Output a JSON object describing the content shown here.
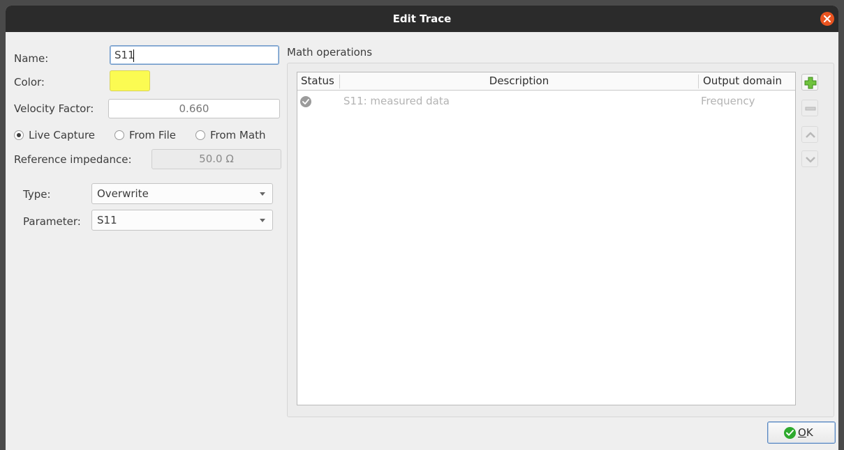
{
  "window": {
    "title": "Edit Trace"
  },
  "form": {
    "name_label": "Name:",
    "name_value": "S11",
    "color_label": "Color:",
    "color_value": "#fbfb52",
    "velocity_label": "Velocity Factor:",
    "velocity_value": "0.660",
    "source_options": [
      {
        "label": "Live Capture",
        "selected": true
      },
      {
        "label": "From File",
        "selected": false
      },
      {
        "label": "From Math",
        "selected": false
      }
    ],
    "impedance_label": "Reference impedance:",
    "impedance_value": "50.0 Ω",
    "type_label": "Type:",
    "type_value": "Overwrite",
    "parameter_label": "Parameter:",
    "parameter_value": "S11"
  },
  "math": {
    "group_label": "Math operations",
    "columns": [
      "Status",
      "Description",
      "Output domain"
    ],
    "rows": [
      {
        "status": "ok-icon",
        "description": "S11: measured data",
        "domain": "Frequency"
      }
    ],
    "buttons": [
      "add-icon",
      "remove-icon",
      "move-up-icon",
      "move-down-icon"
    ]
  },
  "footer": {
    "ok_label": "OK"
  },
  "colors": {
    "titlebar": "#2b2b2b",
    "close": "#e95420",
    "add": "#6fc33d",
    "ok_check": "#2eaa2e"
  }
}
